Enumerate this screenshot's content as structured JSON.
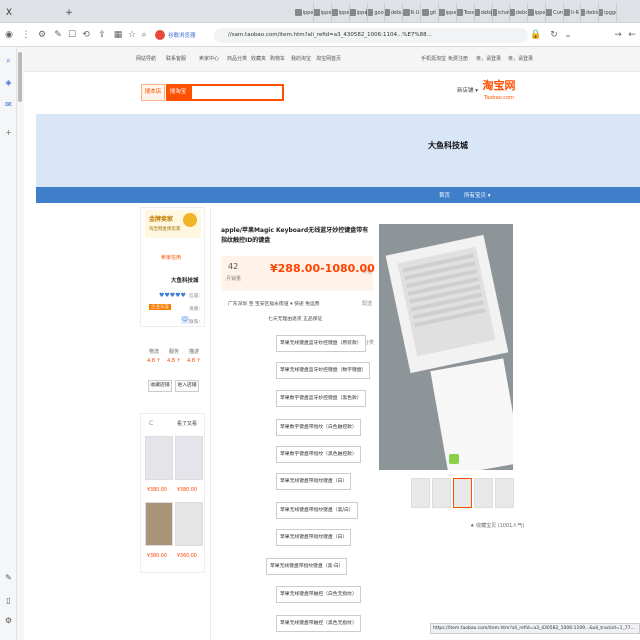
{
  "browser": {
    "tabs": [
      {
        "label": "ipggc"
      },
      {
        "label": "debio"
      },
      {
        "label": "li-R"
      },
      {
        "label": "Cun"
      },
      {
        "label": "ippe"
      },
      {
        "label": "debo"
      },
      {
        "label": "ichat"
      },
      {
        "label": "debo"
      },
      {
        "label": "Toss"
      },
      {
        "label": "ippe"
      },
      {
        "label": "git"
      },
      {
        "label": "R·U"
      },
      {
        "label": "debu"
      },
      {
        "label": "goo"
      },
      {
        "label": "ippe"
      },
      {
        "label": "ippe"
      },
      {
        "label": "ippe"
      },
      {
        "label": "ippe"
      }
    ],
    "new_tab": "+",
    "window_close": "X",
    "address": "//sam.taobao.com/item.htm?ali_refid=a3_430582_1006:1104...%E7%88...",
    "zoom_badge": "谷歌浏览器",
    "status_url": "https://item.taobao.com/item.htm?ali_refid=a3_430582_1006:1109...&ali_trackid=1_77..."
  },
  "site": {
    "topnav_left": [
      "淘宝网首页",
      "我的淘宝",
      "购物车",
      "收藏夹",
      "商品分类",
      "卖家中心",
      "联系客服",
      "网站导航"
    ],
    "topnav_right": [
      "亲，请登录",
      "免费注册",
      "手机逛淘宝"
    ],
    "logo_main": "淘宝网",
    "logo_sub": "Taobao.com",
    "new_store_btn": "新店铺 ▾",
    "search_btn": "搜淘宝",
    "search_shop_btn": "搜本店",
    "shop_banner_title": "大鱼科技城",
    "bluebar_items": [
      "所有宝贝 ▾",
      "首页"
    ]
  },
  "product": {
    "title": "apple/苹果Magic Keyboard无线蓝牙妙控键盘带有指纹触控ID的键盘",
    "price_label": "价格",
    "price": "¥288.00-1080.00",
    "sales_count": "42",
    "sales_label": "月销量",
    "ship_label": "配送",
    "ship_text": "广东深圳 至 宝安区福永街道 ▾  快递 免运费",
    "promise": "七天无理由退货  正品保证",
    "sku_label": "颜色分类",
    "skus": [
      "苹果无线键盘蓝牙妙控键盘（原装款）",
      "苹果无线键盘蓝牙妙控键盘（数字键盘）",
      "苹果数字键盘蓝牙妙控键盘（黑色款）",
      "苹果数字键盘带指纹（白色触控款）",
      "苹果数字键盘带指纹（黑色触控款）",
      "苹果无线键盘带指纹键盘（白）",
      "苹果无线键盘带指纹键盘（黑/白）",
      "苹果无线键盘带指纹键盘（白）",
      "苹果无线键盘带指纹键盘（黑·白）",
      "苹果无线键盘带触控（白色无指纹）",
      "苹果无线键盘带触控（黑色无指纹）"
    ],
    "favorite": "★ 收藏宝贝 (1001人气)"
  },
  "shopcard": {
    "badge": "金牌卖家",
    "badge_sub": "淘宝网金牌卖家",
    "desc_score_label": "描述",
    "quality": "卖家信用",
    "shop_name": "大鱼科技城",
    "credit_label": "信誉：",
    "credit": "♥♥♥♥♥",
    "aptitude_label": "资质：",
    "aptitude": "企业认证",
    "contact_label": "联系：",
    "score_labels": [
      "描述",
      "服务",
      "物流"
    ],
    "score_values": [
      "4.8 ↑",
      "4.8 ↑",
      "4.8 ↑"
    ],
    "enter_shop": "进入店铺",
    "fav_shop": "收藏店铺"
  },
  "recommend": {
    "title": "看了又看",
    "refresh": "C",
    "prices": [
      "¥380.00",
      "¥380.00",
      "¥360.00",
      "¥380.00"
    ]
  },
  "colors": {
    "accent": "#ff5000",
    "bluebar": "#3f7fc9",
    "banner": "#d9e6f7"
  }
}
